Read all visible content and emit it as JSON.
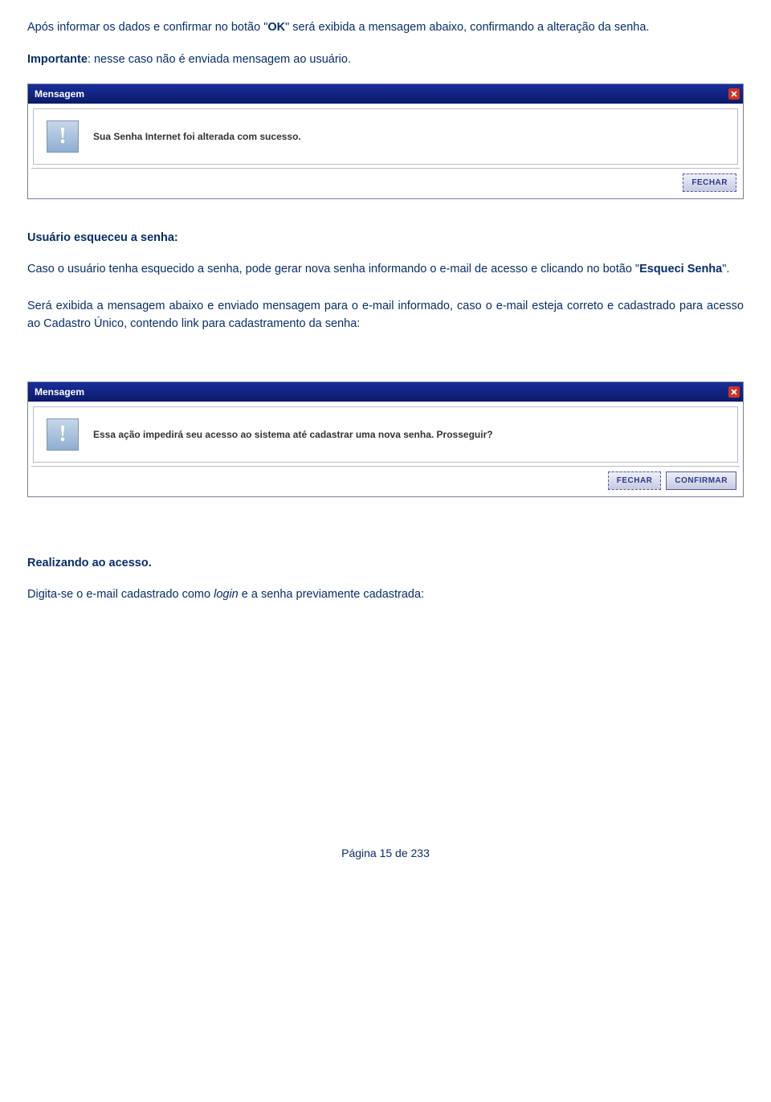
{
  "para1_pre": "Após informar os dados e confirmar no botão ",
  "para1_quote_open": "\"",
  "para1_ok": "OK",
  "para1_quote_close": "\"",
  "para1_post": " será exibida a mensagem abaixo, confirmando a alteração da senha.",
  "para2_label": "Importante",
  "para2_text": ": nesse caso não é enviada mensagem ao usuário.",
  "dialog1": {
    "title": "Mensagem",
    "message": "Sua Senha Internet foi alterada com sucesso.",
    "close_btn": "FECHAR"
  },
  "section_forgot_title": "Usuário esqueceu a senha:",
  "forgot_p1_pre": "Caso o usuário tenha esquecido a senha, pode gerar nova senha informando o e-mail de acesso e clicando no botão \"",
  "forgot_p1_bold": "Esqueci Senha",
  "forgot_p1_post": "\".",
  "forgot_p2": "Será exibida a mensagem abaixo e enviado mensagem para o e-mail informado, caso o e-mail esteja correto e cadastrado para acesso ao Cadastro Único, contendo link para cadastramento da senha:",
  "dialog2": {
    "title": "Mensagem",
    "message": "Essa ação impedirá seu acesso ao sistema até cadastrar uma nova senha. Prosseguir?",
    "close_btn": "FECHAR",
    "confirm_btn": "CONFIRMAR"
  },
  "access_title": "Realizando ao acesso.",
  "access_p1_pre": "Digita-se o e-mail cadastrado como ",
  "access_p1_italic": "login",
  "access_p1_post": " e a senha previamente cadastrada:",
  "page_footer": "Página 15 de 233"
}
